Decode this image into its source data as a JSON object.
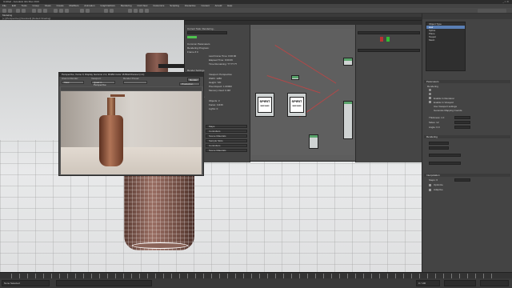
{
  "app": {
    "title": "Untitled - Autodesk 3ds Max 2019",
    "window_controls": "_ □ ✕"
  },
  "menu": [
    "File",
    "Edit",
    "Tools",
    "Group",
    "Views",
    "Create",
    "Modifiers",
    "Animation",
    "Graph Editors",
    "Rendering",
    "Civil View",
    "Customize",
    "Scripting",
    "Interactive",
    "Content",
    "Arnold",
    "Help"
  ],
  "ribbon_label": "Modeling",
  "viewport_label": "[+] [Perspective] [Standard] [Default Shading]",
  "render_window": {
    "title": "Perspective, frame 0, Display Gamma: 2.2, RGBA Color 16 Bits/Channel (1:1)",
    "area_to_render_label": "Area to Render:",
    "area_to_render_value": "View",
    "viewport_label": "Viewport:",
    "viewport_value": "Quad 4 - Perspective",
    "render_preset_label": "Render Preset:",
    "render_preset_value": "",
    "render_button": "Render",
    "production_value": "Production"
  },
  "slate": {
    "status_header": "Rendering",
    "lines": [
      "Current Task: Rendering...",
      "Common Parameters",
      "Rendering Progress:",
      "Frame # 0",
      "Last Frame Time: 0:00:00",
      "Elapsed Time: 0:00:09",
      "Time Remaining: ??:??:??",
      "Render Settings",
      "Viewport: Perspective",
      "Width: 1280",
      "Height: 720",
      "Pixel Aspect: 1.00000",
      "Memory Used: 0.0M",
      "Scene Statistics",
      "Objects: 3",
      "Faces: 11136",
      "Lights: 0"
    ],
    "rollups": [
      "Maps",
      "Controllers",
      "Scene Materials",
      "Sample Slots",
      "Controllers",
      "Scene Materials"
    ],
    "thumb_text_a": "SPIRIT\nNEW MAKE",
    "thumb_text_b": "SPIRIT\nNEW MAKE"
  },
  "command_panel": {
    "list": [
      "Object Type",
      "Hair",
      "Spline",
      "Plane",
      "Teapot",
      "Mesh"
    ],
    "rollups": [
      "Parameters",
      "Rendering",
      "Interpolation"
    ],
    "labels": [
      "Rendering",
      "Enable In Renderer",
      "Enable In Viewport",
      "Use Viewport settings",
      "Generate Mapping Coords.",
      "Thickness: 1.0",
      "Sides: 12",
      "Angle: 0.0",
      "Interpolation",
      "Steps: 6",
      "Optimize",
      "Adaptive"
    ]
  },
  "status": {
    "selection": "None Selected",
    "frame": "0 / 100"
  },
  "colors": {
    "accent": "#5a7fb5",
    "node_header": "#59a36b",
    "wire": "#b34848",
    "bottle": "#9a6f63"
  }
}
